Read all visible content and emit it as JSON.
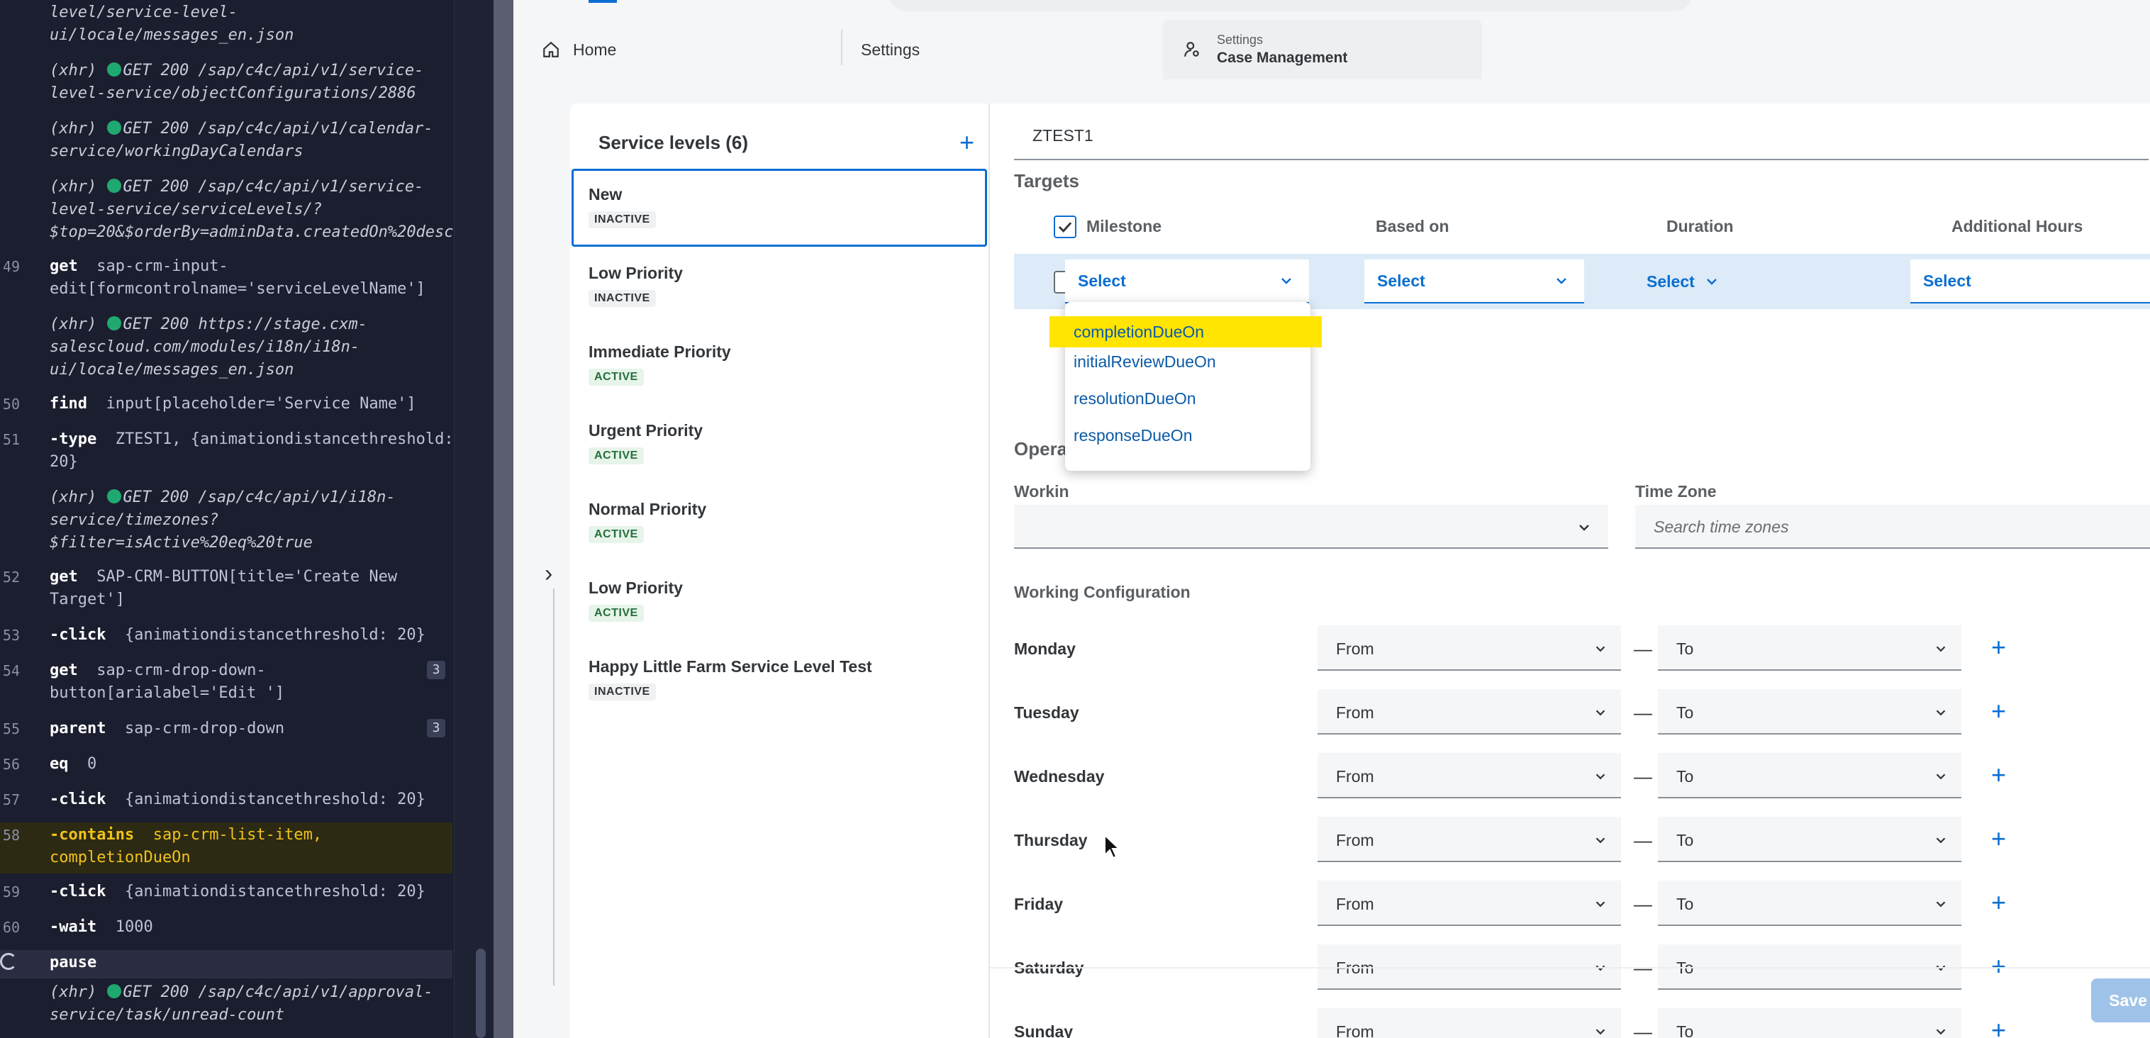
{
  "log": {
    "rows": [
      {
        "num": "",
        "kind": "cont",
        "text1": "level/service-level-",
        "text2": "ui/locale/messages_en.json"
      },
      {
        "num": "",
        "kind": "xhr",
        "text1": "GET 200 /sap/c4c/api/v1/service-",
        "text2": "level-service/objectConfigurations/2886"
      },
      {
        "num": "",
        "kind": "xhr",
        "text1": "GET 200 /sap/c4c/api/v1/calendar-",
        "text2": "service/workingDayCalendars"
      },
      {
        "num": "",
        "kind": "xhr",
        "text1": "GET 200 /sap/c4c/api/v1/service-",
        "text2": "level-service/serviceLevels/?",
        "text3": "$top=20&$orderBy=adminData.createdOn%20desc"
      },
      {
        "num": "49",
        "kind": "cmd",
        "cmd": "get",
        "text1": "sap-crm-input-",
        "text2": "edit[formcontrolname='serviceLevelName']"
      },
      {
        "num": "",
        "kind": "xhr",
        "text1": "GET 200 https://stage.cxm-",
        "text2": "salescloud.com/modules/i18n/i18n-",
        "text3": "ui/locale/messages_en.json"
      },
      {
        "num": "50",
        "kind": "cmd",
        "cmd": "find",
        "text1": "input[placeholder='Service Name']"
      },
      {
        "num": "51",
        "kind": "cmd",
        "cmd": "-type",
        "text1": "ZTEST1, {animationdistancethreshold:",
        "text2": "20}"
      },
      {
        "num": "",
        "kind": "xhr",
        "text1": "GET 200 /sap/c4c/api/v1/i18n-",
        "text2": "service/timezones?",
        "text3": "$filter=isActive%20eq%20true"
      },
      {
        "num": "52",
        "kind": "cmd",
        "cmd": "get",
        "text1": "SAP-CRM-BUTTON[title='Create New",
        "text2": "Target']"
      },
      {
        "num": "53",
        "kind": "cmd",
        "cmd": "-click",
        "text1": "{animationdistancethreshold: 20}"
      },
      {
        "num": "54",
        "kind": "cmd",
        "cmd": "get",
        "text1": "sap-crm-drop-down-",
        "text2": "button[arialabel='Edit ']",
        "badge": "3"
      },
      {
        "num": "55",
        "kind": "cmd",
        "cmd": "parent",
        "text1": "sap-crm-drop-down",
        "badge": "3"
      },
      {
        "num": "56",
        "kind": "cmd",
        "cmd": "eq",
        "text1": "0"
      },
      {
        "num": "57",
        "kind": "cmd",
        "cmd": "-click",
        "text1": "{animationdistancethreshold: 20}"
      },
      {
        "num": "58",
        "kind": "cmd",
        "cmd": "-contains",
        "text1": "sap-crm-list-item,",
        "text2": "completionDueOn",
        "highlight": true
      },
      {
        "num": "59",
        "kind": "cmd",
        "cmd": "-click",
        "text1": "{animationdistancethreshold: 20}"
      },
      {
        "num": "60",
        "kind": "cmd",
        "cmd": "-wait",
        "text1": "1000"
      },
      {
        "num": "",
        "kind": "pending",
        "cmd": "pause"
      },
      {
        "num": "",
        "kind": "xhr",
        "text1": "GET 200 /sap/c4c/api/v1/approval-",
        "text2": "service/task/unread-count"
      }
    ],
    "xhr_label": "(xhr)"
  },
  "tabs": {
    "home": "Home",
    "settings": "Settings",
    "active_small": "Settings",
    "active_big": "Case Management"
  },
  "service_levels": {
    "title": "Service levels (6)",
    "add": "+",
    "items": [
      {
        "name": "New",
        "status": "INACTIVE"
      },
      {
        "name": "Low Priority",
        "status": "INACTIVE"
      },
      {
        "name": "Immediate Priority",
        "status": "ACTIVE"
      },
      {
        "name": "Urgent Priority",
        "status": "ACTIVE"
      },
      {
        "name": "Normal Priority",
        "status": "ACTIVE"
      },
      {
        "name": "Low Priority",
        "status": "ACTIVE"
      },
      {
        "name": "Happy Little Farm Service Level Test",
        "status": "INACTIVE"
      }
    ]
  },
  "detail": {
    "name_value": "ZTEST1",
    "targets_title": "Targets",
    "columns": {
      "milestone": "Milestone",
      "based_on": "Based on",
      "duration": "Duration",
      "additional_hours": "Additional Hours"
    },
    "row": {
      "milestone": "Select",
      "based_on": "Select",
      "duration": "Select",
      "additional_hours": "Select"
    },
    "dropdown_options": [
      "completionDueOn",
      "initialReviewDueOn",
      "resolutionDueOn",
      "responseDueOn"
    ],
    "operating_title_partial": "Opera",
    "working_label_partial": "Workin",
    "time_zone_label": "Time Zone",
    "time_zone_placeholder": "Search time zones",
    "working_config_title": "Working Configuration",
    "days": [
      "Monday",
      "Tuesday",
      "Wednesday",
      "Thursday",
      "Friday",
      "Saturday",
      "Sunday"
    ],
    "from_label": "From",
    "to_label": "To",
    "dash": "—",
    "plus": "+",
    "save": "Save"
  },
  "colors": {
    "accent": "#0a6ed1",
    "highlight": "#ffe500",
    "active_badge": "#e6f4ea",
    "log_bg": "#1b1e2e"
  }
}
